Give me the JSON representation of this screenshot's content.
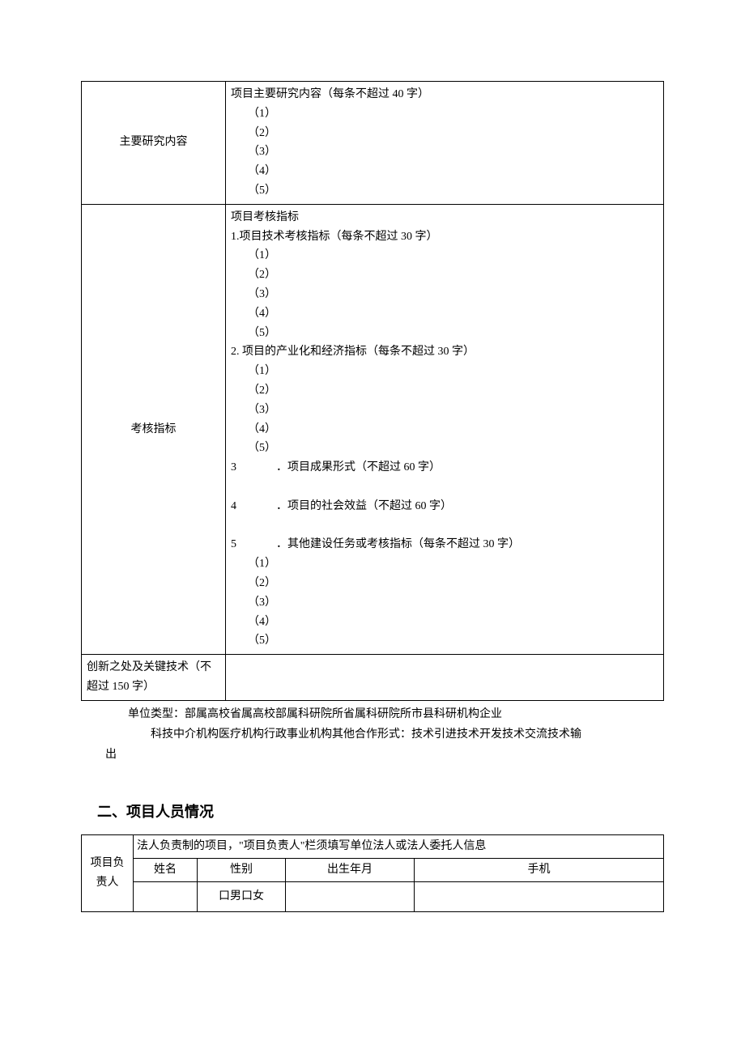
{
  "table1": {
    "row1": {
      "label": "主要研究内容",
      "header": "项目主要研究内容（每条不超过 40 字）",
      "items": [
        "（1）",
        "（2）",
        "（3）",
        "（4）",
        "（5）"
      ]
    },
    "row2": {
      "label": "考核指标",
      "header": "项目考核指标",
      "sec1": {
        "title": "1.项目技术考核指标（每条不超过 30 字）",
        "items": [
          "（1）",
          "（2）",
          "（3）",
          "（4）",
          "（5）"
        ]
      },
      "sec2": {
        "title": "2. 项目的产业化和经济指标（每条不超过 30 字）",
        "items": [
          "（1）",
          "（2）",
          "（3）",
          "（4）",
          "（5）"
        ]
      },
      "sec3": {
        "num": "3",
        "rest": "．项目成果形式（不超过 60 字）"
      },
      "sec4": {
        "num": "4",
        "rest": "．项目的社会效益（不超过 60 字）"
      },
      "sec5": {
        "num": "5",
        "rest": "．其他建设任务或考核指标（每条不超过 30 字）",
        "items": [
          "（1）",
          "（2）",
          "（3）",
          "（4）",
          "（5）"
        ]
      }
    },
    "row3": {
      "label": "创新之处及关键技术（不超过 150 字）",
      "content": ""
    }
  },
  "notes": {
    "line1": "单位类型：部属高校省属高校部属科研院所省属科研院所市县科研机构企业",
    "line2": "科技中介机构医疗机构行政事业机构其他合作形式：技术引进技术开发技术交流技术输",
    "line3": "出"
  },
  "section2": {
    "heading": "二、项目人员情况",
    "rowLabel": "项目负责人",
    "note": "法人负责制的项目，\"项目负责人\"栏须填写单位法人或法人委托人信息",
    "cols": {
      "name": "姓名",
      "gender": "性别",
      "birth": "出生年月",
      "phone": "手机"
    },
    "values": {
      "name": "",
      "gender": "口男口女",
      "birth": "",
      "phone": ""
    }
  }
}
